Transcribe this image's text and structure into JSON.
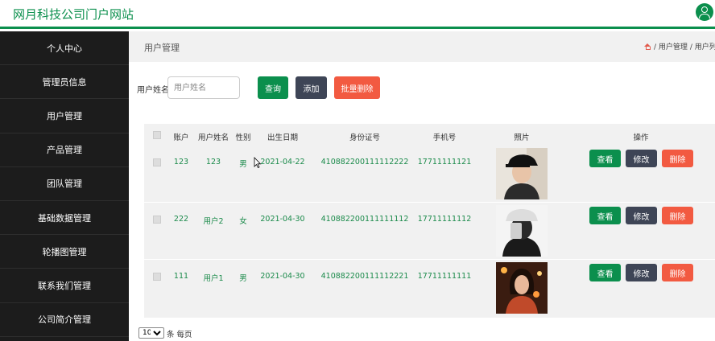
{
  "app": {
    "title": "网月科技公司门户网站"
  },
  "sidebar": {
    "items": [
      {
        "label": "个人中心"
      },
      {
        "label": "管理员信息"
      },
      {
        "label": "用户管理"
      },
      {
        "label": "产品管理"
      },
      {
        "label": "团队管理"
      },
      {
        "label": "基础数据管理"
      },
      {
        "label": "轮播图管理"
      },
      {
        "label": "联系我们管理"
      },
      {
        "label": "公司简介管理"
      }
    ]
  },
  "header": {
    "page_title": "用户管理",
    "breadcrumb": {
      "level1": "用户管理",
      "level2": "用户列表",
      "separator": "/"
    }
  },
  "search": {
    "label": "用户姓名",
    "placeholder": "用户姓名",
    "value": "",
    "search_button": "查询",
    "add_button": "添加",
    "batch_delete_button": "批量删除"
  },
  "table": {
    "columns": [
      "账户",
      "用户姓名",
      "性别",
      "出生日期",
      "身份证号",
      "手机号",
      "照片",
      "操作"
    ],
    "rows": [
      {
        "account": "123",
        "name": "123",
        "gender": "男",
        "birth": "2021-04-22",
        "id_card": "410882200111112222",
        "phone": "17711111121",
        "photo": "photo-young-man-cap"
      },
      {
        "account": "222",
        "name": "用户2",
        "gender": "女",
        "birth": "2021-04-30",
        "id_card": "410882200111111112",
        "phone": "17711111112",
        "photo": "photo-mirror-selfie"
      },
      {
        "account": "111",
        "name": "用户1",
        "gender": "男",
        "birth": "2021-04-30",
        "id_card": "410882200111112221",
        "phone": "17711111111",
        "photo": "photo-woman-night"
      }
    ],
    "actions": {
      "view": "查看",
      "edit": "修改",
      "delete": "删除"
    }
  },
  "pagination": {
    "page_size": "10",
    "per_page_label": "条 每页"
  },
  "colors": {
    "primary": "#0b8f4d",
    "dark": "#3e4556",
    "danger": "#f25a41",
    "sidebar": "#1c1c1c"
  }
}
